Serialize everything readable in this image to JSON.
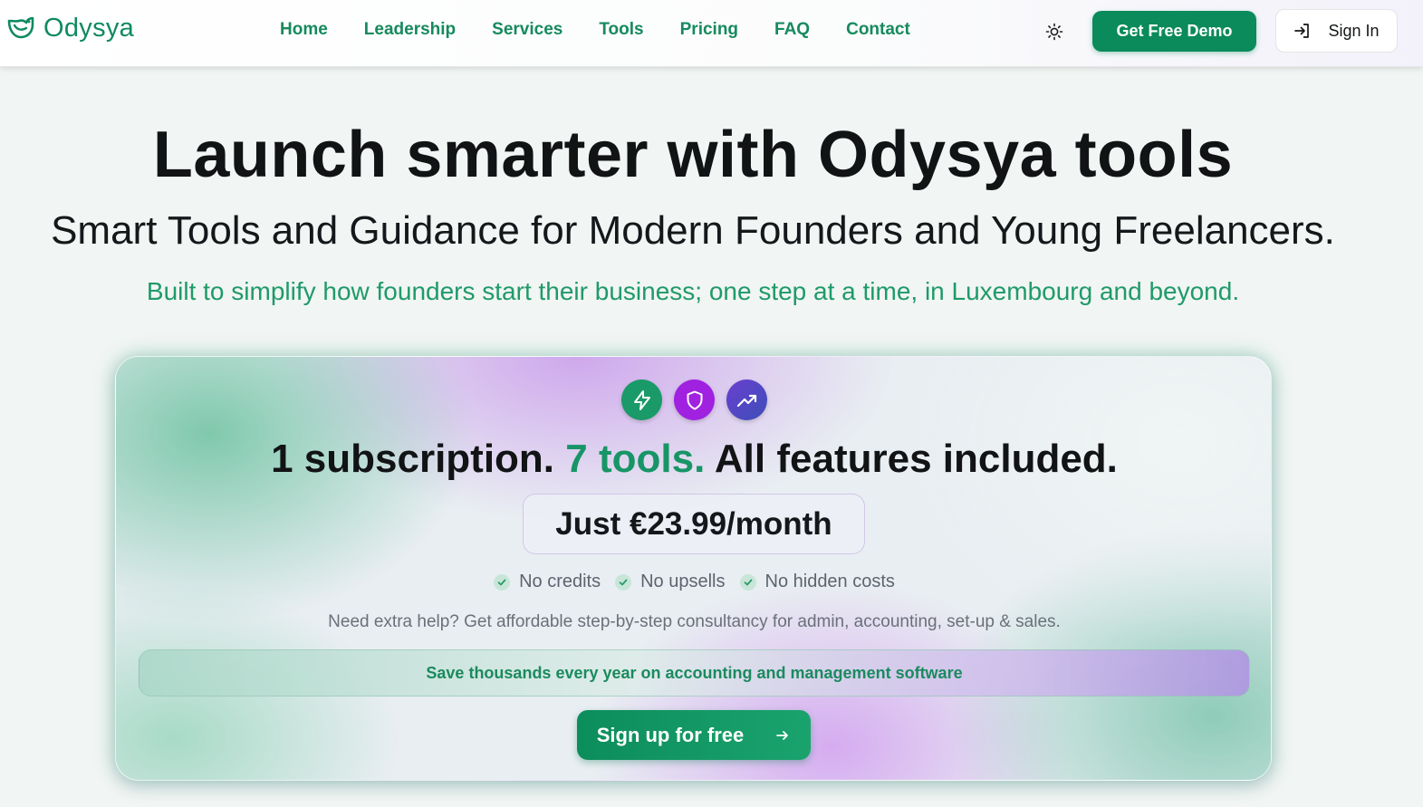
{
  "brand": {
    "name": "Odysya",
    "logo_icon": "bird-icon",
    "accent": "#0b8a5b"
  },
  "nav": {
    "links": [
      "Home",
      "Leadership",
      "Services",
      "Tools",
      "Pricing",
      "FAQ",
      "Contact"
    ],
    "theme_icon": "sun-icon",
    "demo_label": "Get Free Demo",
    "signin_label": "Sign In",
    "signin_icon": "login-icon"
  },
  "hero": {
    "title": "Launch smarter with Odysya tools",
    "subtitle": "Smart Tools and Guidance for Modern Founders and Young Freelancers.",
    "tagline": "Built to simplify how founders start their business; one step at a time, in Luxembourg and beyond."
  },
  "card": {
    "badges": [
      {
        "icon": "lightning-icon",
        "color": "#1a9a68"
      },
      {
        "icon": "shield-icon",
        "color": "#a021e0"
      },
      {
        "icon": "trending-up-icon",
        "color": "#5a45c8"
      }
    ],
    "title_part1": "1 subscription.",
    "title_highlight": "7 tools.",
    "title_part2": "All features included.",
    "price": "Just €23.99/month",
    "checks": [
      "No credits",
      "No upsells",
      "No hidden costs"
    ],
    "help_text": "Need extra help? Get affordable step-by-step consultancy for admin, accounting, set-up & sales.",
    "banner": "Save thousands every year on accounting and management software",
    "cta_label": "Sign up for free",
    "cta_icon": "arrow-right-icon"
  }
}
